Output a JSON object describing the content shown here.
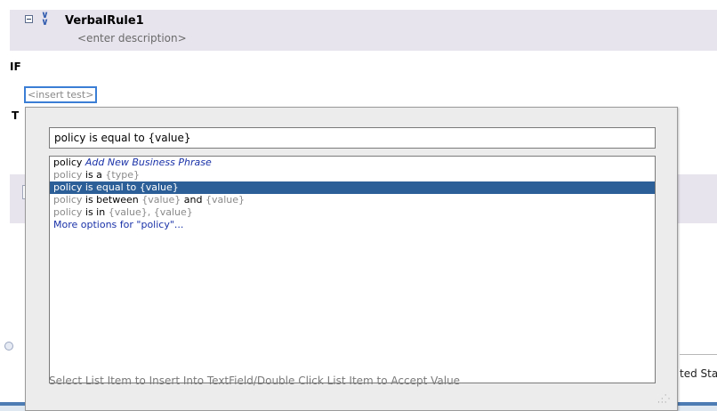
{
  "rule": {
    "name": "VerbalRule1",
    "description": "<enter description>"
  },
  "if_label": "IF",
  "insert_test": "<insert test>",
  "then_label": "T",
  "status_tab": "ted Sta",
  "popup": {
    "input_value": "policy is equal to {value}",
    "items": [
      {
        "parts": [
          {
            "text": "policy ",
            "style": "t"
          },
          {
            "text": "Add New Business Phrase",
            "style": "blue"
          }
        ]
      },
      {
        "parts": [
          {
            "text": "policy ",
            "style": "g"
          },
          {
            "text": "is a ",
            "style": "t"
          },
          {
            "text": "{type}",
            "style": "g"
          }
        ]
      },
      {
        "parts": [
          {
            "text": "policy is equal to {value}",
            "style": "t"
          }
        ],
        "selected": true
      },
      {
        "parts": [
          {
            "text": "policy ",
            "style": "g"
          },
          {
            "text": "is between ",
            "style": "t"
          },
          {
            "text": "{value} ",
            "style": "g"
          },
          {
            "text": "and ",
            "style": "t"
          },
          {
            "text": "{value}",
            "style": "g"
          }
        ]
      },
      {
        "parts": [
          {
            "text": "policy ",
            "style": "g"
          },
          {
            "text": "is in ",
            "style": "t"
          },
          {
            "text": "{value}, {value}",
            "style": "g"
          }
        ]
      },
      {
        "parts": [
          {
            "text": "More options for \"policy\"...",
            "style": "t"
          }
        ],
        "more": true
      }
    ],
    "hint": "Select List Item to Insert Into TextField/Double Click List Item to Accept Value"
  },
  "colors": {
    "selection": "#2c5f97",
    "link_blue": "#1a32a8",
    "focus_border": "#3a7fd5"
  }
}
